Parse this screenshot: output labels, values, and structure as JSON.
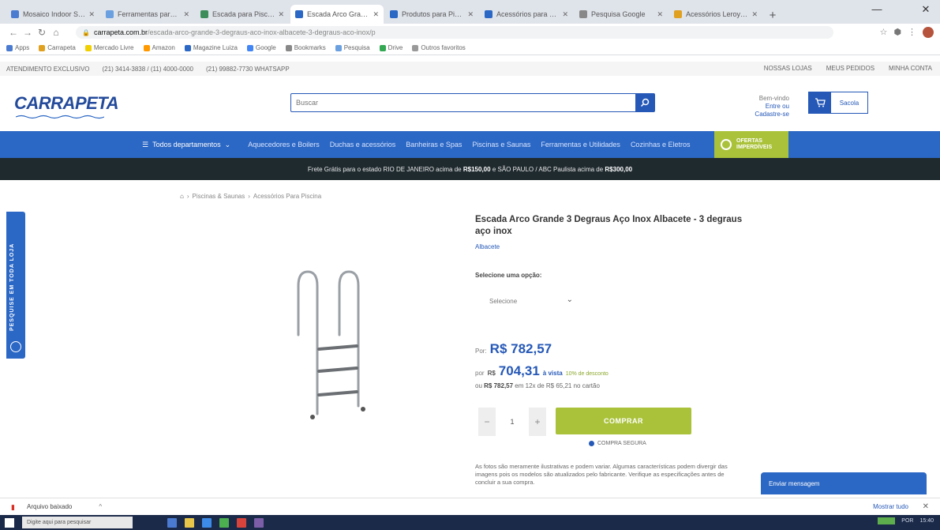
{
  "browser": {
    "tabs": [
      {
        "label": "Mosaico Indoor Sense",
        "color": "#4a7bd0",
        "active": false
      },
      {
        "label": "Ferramentas para Piscina",
        "color": "#6aa0e0",
        "active": false
      },
      {
        "label": "Escada para Piscina",
        "color": "#3c8d5a",
        "active": false
      },
      {
        "label": "Escada Arco Grande 3 Degraus",
        "color": "#2b67c4",
        "active": true
      },
      {
        "label": "Produtos para Piscina",
        "color": "#2b67c4",
        "active": false
      },
      {
        "label": "Acessórios para Piscinas",
        "color": "#2b67c4",
        "active": false
      },
      {
        "label": "Pesquisa Google",
        "color": "#888888",
        "active": false
      },
      {
        "label": "Acessórios Leroy Merlin",
        "color": "#e0a020",
        "active": false
      }
    ],
    "url_host": "carrapeta.com.br",
    "url_path": "/escada-arco-grande-3-degraus-aco-inox-albacete-3-degraus-aco-inox/p",
    "bookmarks": [
      "Apps",
      "Carrapeta",
      "Mercado Livre",
      "Amazon",
      "Magazine Luiza",
      "Google",
      "Bookmarks",
      "Pesquisa",
      "Drive",
      "Outros favoritos"
    ],
    "win_min": "—",
    "win_close": "✕"
  },
  "site": {
    "infobar": {
      "left": [
        "ATENDIMENTO EXCLUSIVO",
        "(21) 3414-3838 / (11) 4000-0000",
        "(21) 99882-7730 WHATSAPP"
      ],
      "right": [
        "NOSSAS LOJAS",
        "MEUS PEDIDOS",
        "MINHA CONTA"
      ]
    },
    "logo": "CARRAPETA",
    "search_placeholder": "Buscar",
    "account_top": "Bem-vindo",
    "account_link": "Entre ou Cadastre-se",
    "cart_label": "Sacola",
    "nav": {
      "all": "Todos departamentos",
      "categories": [
        "Aquecedores e Boilers",
        "Duchas e acessórios",
        "Banheiras e Spas",
        "Piscinas e Saunas",
        "Ferramentas e Utilidades",
        "Cozinhas e Eletros"
      ]
    },
    "offers": "OFERTAS IMPERDÍVEIS",
    "shipping_text_pre": "Frete Grátis para o estado RIO DE JANEIRO acima de",
    "shipping_value_1": "R$150,00",
    "shipping_text_mid": "e SÃO PAULO / ABC Paulista acima de",
    "shipping_value_2": "R$300,00",
    "side_tab": "PESQUISE EM TODA LOJA"
  },
  "product": {
    "breadcrumb": [
      "Piscinas & Saunas",
      "Acessórios Para Piscina"
    ],
    "title": "Escada Arco Grande 3 Degraus Aço Inox Albacete - 3 degraus aço inox",
    "brand": "Albacete",
    "option_label": "Selecione uma opção:",
    "select_value": "Selecione",
    "price_prefix": "Por:",
    "price": "R$ 782,57",
    "cash_prefix": "por",
    "cash_currency": "R$",
    "cash_price": "704,31",
    "cash_suffix": "à vista",
    "cash_discount": "10% de desconto",
    "installments_pre": "ou",
    "installments_total": "R$ 782,57",
    "installments_rest": "em 12x de R$ 65,21 no cartão",
    "qty_minus": "−",
    "qty_value": "1",
    "qty_plus": "+",
    "buy_label": "COMPRAR",
    "buy_sub": "COMPRA SEGURA",
    "description": "As fotos são meramente ilustrativas e podem variar. Algumas características podem divergir das imagens pois os modelos são atualizados pelo fabricante. Verifique as especificações antes de concluir a sua compra."
  },
  "chat_label": "Enviar mensagem",
  "download": {
    "file": "Arquivo baixado",
    "show_all": "Mostrar tudo",
    "close": "✕"
  },
  "taskbar": {
    "search_placeholder": "Digite aqui para pesquisar",
    "apps": [
      "#4a7bd0",
      "#e8c64a",
      "#3d8be8",
      "#4caf50",
      "#d8443b",
      "#7b5ea7"
    ],
    "tray": [
      "POR",
      "15:40"
    ]
  }
}
